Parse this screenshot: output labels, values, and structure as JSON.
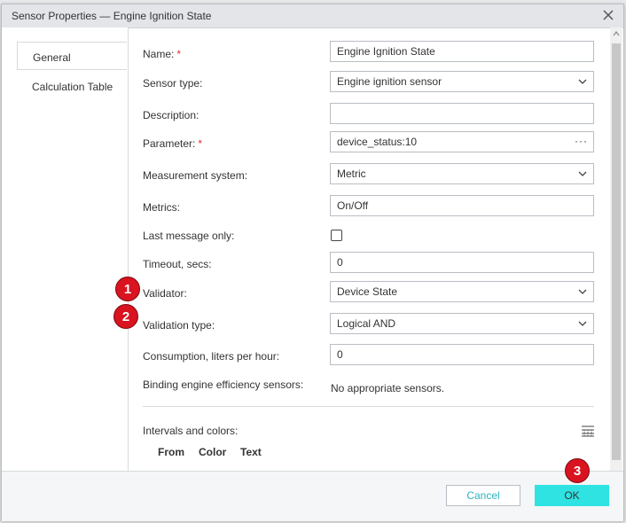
{
  "dialog": {
    "title": "Sensor Properties — Engine Ignition State",
    "tabs": [
      {
        "label": "General"
      },
      {
        "label": "Calculation Table"
      }
    ]
  },
  "form": {
    "name": {
      "label": "Name:",
      "required": "*",
      "value": "Engine Ignition State"
    },
    "sensor_type": {
      "label": "Sensor type:",
      "value": "Engine ignition sensor"
    },
    "description": {
      "label": "Description:",
      "value": ""
    },
    "parameter": {
      "label": "Parameter:",
      "required": "*",
      "value": "device_status:10",
      "more": "···"
    },
    "measurement_system": {
      "label": "Measurement system:",
      "value": "Metric"
    },
    "metrics": {
      "label": "Metrics:",
      "value": "On/Off"
    },
    "last_message_only": {
      "label": "Last message only:",
      "checked": false
    },
    "timeout": {
      "label": "Timeout, secs:",
      "value": "0"
    },
    "validator": {
      "label": "Validator:",
      "value": "Device State"
    },
    "validation_type": {
      "label": "Validation type:",
      "value": "Logical AND"
    },
    "consumption": {
      "label": "Consumption, liters per hour:",
      "value": "0"
    },
    "binding": {
      "label": "Binding engine efficiency sensors:",
      "value": "No appropriate sensors."
    },
    "intervals": {
      "label": "Intervals and colors:",
      "columns": [
        "From",
        "Color",
        "Text"
      ]
    }
  },
  "footer": {
    "cancel_label": "Cancel",
    "ok_label": "OK"
  },
  "annotations": [
    "1",
    "2",
    "3"
  ],
  "colors": {
    "accent": "#2fe3e3",
    "cancel_text": "#2bb3c0",
    "required": "#e03131",
    "badge": "#d9131f"
  }
}
